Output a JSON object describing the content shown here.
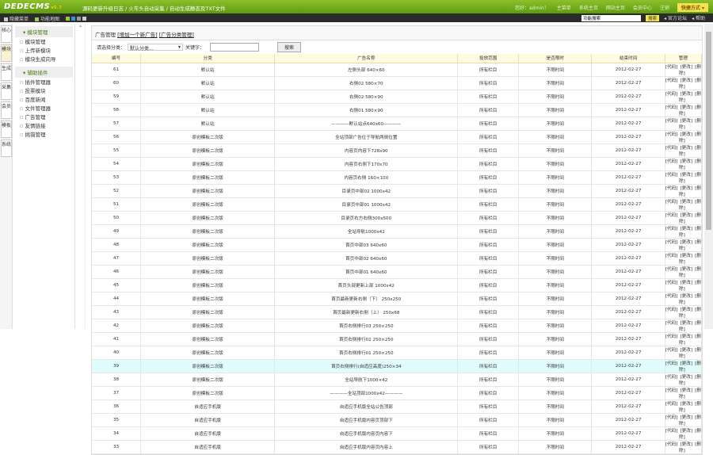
{
  "header": {
    "logo": "DEDECMS",
    "version": "v5.7",
    "links": [
      "源码更新升级日志",
      "/",
      "火车头自动采集",
      "/",
      "自动生成静态及TXT文件"
    ],
    "user": "您好：admin！",
    "user_links": [
      "主菜单",
      "系统主页",
      "网站主页",
      "会员中心",
      "注销"
    ],
    "quick": "快捷方式"
  },
  "nav2": {
    "left": [
      "隐藏菜单",
      "功能地图"
    ],
    "search_value": "功能搜索",
    "search_btn": "搜索",
    "right": [
      "官方论坛",
      "帮助"
    ]
  },
  "tabs": [
    "核心",
    "模块",
    "生成",
    "采集",
    "会员",
    "模板",
    "系统"
  ],
  "sidebar": {
    "groups": [
      {
        "title": "模块管理",
        "items": [
          "模块管理",
          "上传新模块",
          "模块生成向导"
        ]
      },
      {
        "title": "辅助插件",
        "items": [
          "插件管理器",
          "投票模块",
          "百度新闻",
          "文件管理器",
          "广告管理",
          "友情链接",
          "挑错管理"
        ]
      }
    ]
  },
  "panel": {
    "title": "广告管理",
    "add_link": "[增加一个新广告]",
    "cat_link": "[广告分类管理]",
    "search_label": "请选择分类：",
    "select_value": "默认分类...",
    "keyword_label": "关键字：",
    "search_btn": "搜索"
  },
  "table": {
    "columns": [
      "编号",
      "分类",
      "广告名称",
      "投放范围",
      "是否限时",
      "结束时间",
      "管理"
    ],
    "actions": [
      "[代码]",
      "[更改]",
      "[删除]"
    ],
    "rows": [
      [
        "61",
        "默认站",
        "左侧头部 640×60",
        "所有栏目",
        "不限时间",
        "2012-02-27"
      ],
      [
        "60",
        "默认站",
        "右侧02 580×70",
        "所有栏目",
        "不限时间",
        "2012-02-27"
      ],
      [
        "59",
        "默认站",
        "右侧02 580×90",
        "所有栏目",
        "不限时间",
        "2012-02-27"
      ],
      [
        "58",
        "默认站",
        "右侧01 580×90",
        "所有栏目",
        "不限时间",
        "2012-02-27"
      ],
      [
        "57",
        "默认站",
        "————默认站点640x60————",
        "所有栏目",
        "不限时间",
        "2012-02-27"
      ],
      [
        "56",
        "原创模板二次版",
        "全站顶部广告位于导航两侧位置",
        "所有栏目",
        "不限时间",
        "2012-02-27"
      ],
      [
        "55",
        "原创模板二次版",
        "内容页内容下728x90",
        "所有栏目",
        "不限时间",
        "2012-02-27"
      ],
      [
        "54",
        "原创模板二次版",
        "内容页右侧下170x70",
        "所有栏目",
        "不限时间",
        "2012-02-27"
      ],
      [
        "53",
        "原创模板二次版",
        "内容页右侧 160×100",
        "所有栏目",
        "不限时间",
        "2012-02-27"
      ],
      [
        "52",
        "原创模板二次版",
        "目录页中部02 1000x42",
        "所有栏目",
        "不限时间",
        "2012-02-27"
      ],
      [
        "51",
        "原创模板二次版",
        "目录页中部01 1000x42",
        "所有栏目",
        "不限时间",
        "2012-02-27"
      ],
      [
        "50",
        "原创模板二次版",
        "目录页右方右侧300x500",
        "所有栏目",
        "不限时间",
        "2012-02-27"
      ],
      [
        "49",
        "原创模板二次版",
        "全站导航1000x42",
        "所有栏目",
        "不限时间",
        "2012-02-27"
      ],
      [
        "48",
        "原创模板二次版",
        "首页中部03 640x60",
        "所有栏目",
        "不限时间",
        "2012-02-27"
      ],
      [
        "47",
        "原创模板二次版",
        "首页中部02 640x60",
        "所有栏目",
        "不限时间",
        "2012-02-27"
      ],
      [
        "46",
        "原创模板二次版",
        "首页中部01 640x60",
        "所有栏目",
        "不限时间",
        "2012-02-27"
      ],
      [
        "45",
        "原创模板二次版",
        "首页头部更新上部 1000x42",
        "所有栏目",
        "不限时间",
        "2012-02-27"
      ],
      [
        "44",
        "原创模板二次版",
        "首页最新更新右侧（下） 250x250",
        "所有栏目",
        "不限时间",
        "2012-02-27"
      ],
      [
        "43",
        "原创模板二次版",
        "首页最新更新右侧（上） 250x68",
        "所有栏目",
        "不限时间",
        "2012-02-27"
      ],
      [
        "42",
        "原创模板二次版",
        "首页右侧排行03 250×250",
        "所有栏目",
        "不限时间",
        "2012-02-27"
      ],
      [
        "41",
        "原创模板二次版",
        "首页右侧排行02 250×250",
        "所有栏目",
        "不限时间",
        "2012-02-27"
      ],
      [
        "40",
        "原创模板二次版",
        "首页右侧排行01 250×250",
        "所有栏目",
        "不限时间",
        "2012-02-27"
      ],
      [
        "39",
        "原创模板二次版",
        "首页右侧排行(自适应高度)250×34",
        "所有栏目",
        "不限时间",
        "2012-02-27"
      ],
      [
        "38",
        "原创模板二次版",
        "全站导航下1000×42",
        "所有栏目",
        "不限时间",
        "2012-02-27"
      ],
      [
        "37",
        "原创模板二次版",
        "————全站顶部1000x42————",
        "所有栏目",
        "不限时间",
        "2012-02-27"
      ],
      [
        "36",
        "自适应手机版",
        "自适应手机版全站公告顶部",
        "所有栏目",
        "不限时间",
        "2012-02-27"
      ],
      [
        "35",
        "自适应手机版",
        "自适应手机版内容页顶部下",
        "所有栏目",
        "不限时间",
        "2012-02-27"
      ],
      [
        "34",
        "自适应手机版",
        "自适应手机版内容页内容下",
        "所有栏目",
        "不限时间",
        "2012-02-27"
      ],
      [
        "33",
        "自适应手机版",
        "自适应手机版内容页内容上",
        "所有栏目",
        "不限时间",
        "2012-02-27"
      ]
    ],
    "highlight_row": "39"
  }
}
